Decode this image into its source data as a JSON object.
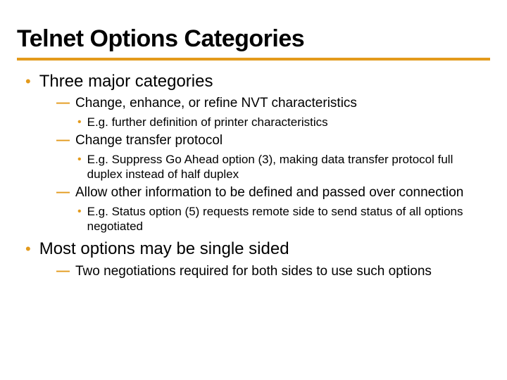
{
  "title": "Telnet Options Categories",
  "items": [
    {
      "text": "Three major categories",
      "children": [
        {
          "text": "Change, enhance, or refine NVT characteristics",
          "children": [
            {
              "text": "E.g. further definition of printer characteristics"
            }
          ]
        },
        {
          "text": "Change transfer protocol",
          "children": [
            {
              "text": "E.g. Suppress Go Ahead option (3), making data transfer protocol full duplex instead of half duplex"
            }
          ]
        },
        {
          "text": "Allow other information to be defined and passed over connection",
          "children": [
            {
              "text": "E.g. Status option (5) requests remote side to send status of all options negotiated"
            }
          ]
        }
      ]
    },
    {
      "text": "Most options may be single sided",
      "children": [
        {
          "text": "Two negotiations required for both sides to use such options"
        }
      ]
    }
  ]
}
